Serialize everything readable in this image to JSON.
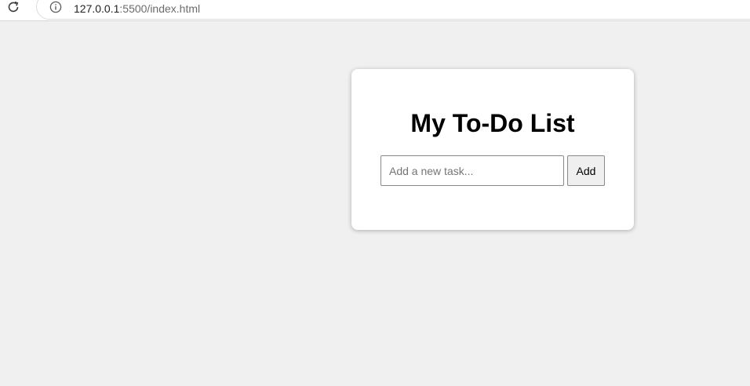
{
  "browser": {
    "url_host": "127.0.0.1",
    "url_rest": ":5500/index.html",
    "reload_icon": "reload-icon",
    "info_icon": "info-icon"
  },
  "todo": {
    "title": "My To-Do List",
    "input_placeholder": "Add a new task...",
    "input_value": "",
    "add_label": "Add"
  },
  "colors": {
    "page_background": "#f0f0f0",
    "card_background": "#ffffff"
  }
}
